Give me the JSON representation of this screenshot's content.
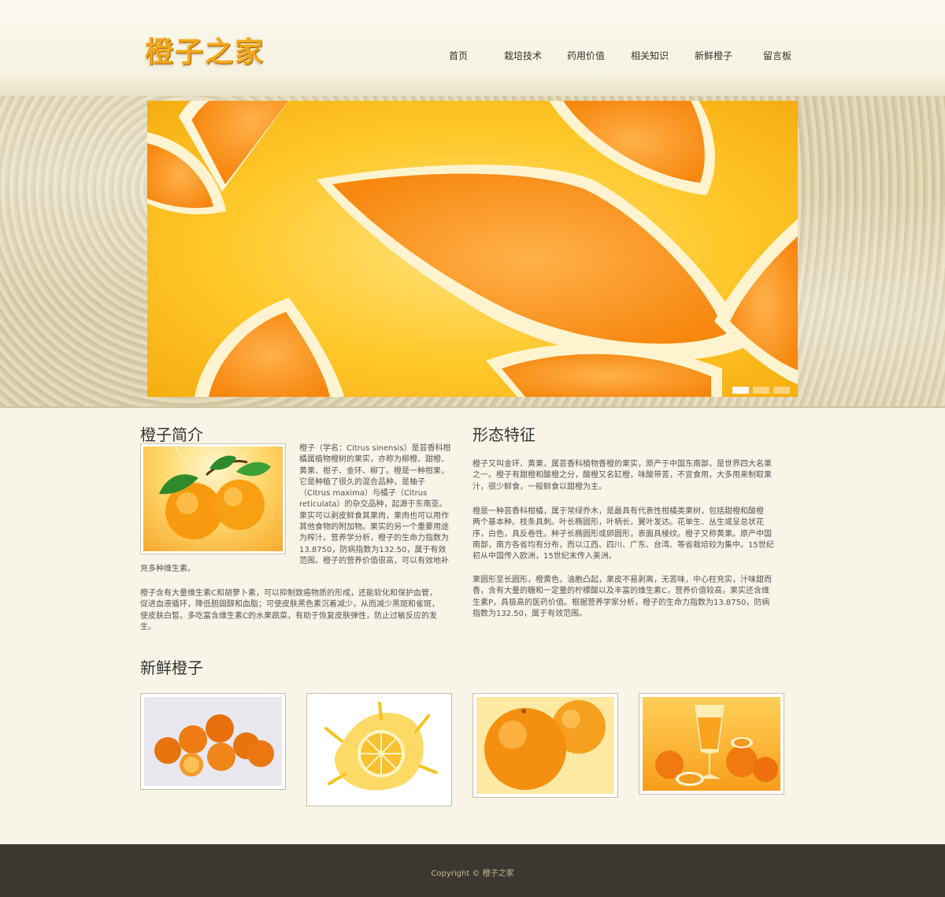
{
  "header": {
    "logo": "橙子之家",
    "nav": [
      {
        "label": "首页"
      },
      {
        "label": "栽培技术"
      },
      {
        "label": "药用价值"
      },
      {
        "label": "相关知识"
      },
      {
        "label": "新鲜橙子"
      },
      {
        "label": "留言板"
      }
    ]
  },
  "banner": {
    "image_icon": "orange-slices-image",
    "dots": 3,
    "active_dot": 0
  },
  "intro": {
    "title": "橙子简介",
    "image_icon": "oranges-with-leaves-image",
    "lines_beside": [
      "橙子（学名：Citrus sinensis）是芸香科柑",
      "橘属植物橙树的果实，亦称为柳橙、甜橙、",
      "黄果、柑子、金环、柳丁。橙是一种柑果，",
      "它是种植了很久的混合品种，是柚子",
      "（Citrus maxima）与橘子（Citrus",
      "reticulata）的杂交品种，起源于东南亚。",
      "果实可以剥皮鲜食其果肉，果肉也可以用作",
      "其他食物的附加物。果实的另一个重要用途",
      "为榨汁。营养学分析，橙子的生命力指数为",
      "13.8750，防病指数为132.50，属于有效",
      "范围。橙子的营养价值很高，可以有效地补"
    ],
    "line_below": "充多种维生素。",
    "second_paragraph": [
      "橙子含有大量维生素C和胡萝卜素，可以抑制致癌物质的形成，还能软化和保护血管，",
      "促进血液循环，降低胆固醇和血脂；可使皮肤黑色素沉着减少，从而减少黑斑和雀斑，",
      "使皮肤白皙。多吃富含维生素C的水果蔬菜，有助于恢复皮肤弹性，防止过敏反应的发",
      "生。"
    ]
  },
  "features": {
    "title": "形态特征",
    "paragraphs": [
      [
        "橙子又叫金环、黄果，属芸香科植物香橙的果实，原产于中国东南部，是世界四大名果",
        "之一。橙子有甜橙和酸橙之分，酸橙又名缸橙，味酸带苦，不宜食用，大多用来制取果",
        "汁，很少鲜食，一般鲜食以甜橙为主。"
      ],
      [
        "橙是一种芸香科柑橘，属于常绿乔木，是最具有代表性柑橘类果树，包括甜橙和酸橙",
        "两个基本种。枝条具刺。叶长椭圆形，叶柄长，翼叶发达。花单生、丛生或呈总状花",
        "序，白色，具反卷性。种子长椭圆形或卵圆形，表面具棱纹。橙子又称黄果。原产中国",
        "南部，南方各省均有分布，而以江西、四川、广东、台湾、等省栽培较为集中。15世纪",
        "初从中国传入欧洲，15世纪末传入美洲。"
      ],
      [
        "果圆形至长圆形，橙黄色，油胞凸起，果皮不易剥离，无苦味，中心柱充实，汁味甜而",
        "香，含有大量的糖和一定量的柠檬酸以及丰富的维生素C，营养价值较高，果实还含维",
        "生素P，具极高的医药价值。根据营养学家分析，橙子的生命力指数为13.8750，防病",
        "指数为132.50，属于有效范围。"
      ]
    ]
  },
  "fresh": {
    "title": "新鲜橙子",
    "photos": [
      {
        "icon": "orange-pile-image"
      },
      {
        "icon": "orange-juice-splash-image"
      },
      {
        "icon": "whole-oranges-image"
      },
      {
        "icon": "orange-juice-glass-image"
      }
    ]
  },
  "footer": {
    "copyright": "Copyright © 橙子之家"
  },
  "colors": {
    "page_bg": "#f8f5e8",
    "footer_bg": "#3b3832",
    "footer_text": "#c8b68c",
    "logo": "#f0a81d",
    "orange": "#f7a21b"
  }
}
